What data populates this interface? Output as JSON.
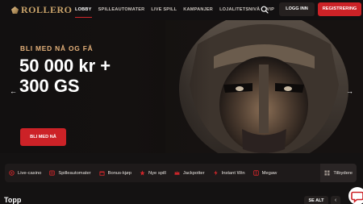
{
  "header": {
    "logo": "ROLLERO",
    "nav": [
      "LOBBY",
      "SPILLEAUTOMATER",
      "LIVE SPILL",
      "KAMPANJER",
      "LOJALITETSNIVÅ",
      "VIP"
    ],
    "login_label": "LOGG INN",
    "register_label": "REGISTRERING"
  },
  "hero": {
    "eyebrow": "BLI MED NÅ OG FÅ",
    "title_line1": "50 000 kr +",
    "title_line2": "300 GS",
    "cta": "BLI MED NÅ",
    "prev_arrow": "←",
    "next_arrow": "→",
    "slides_total": 5,
    "slide_active": 2
  },
  "categories": [
    {
      "label": "Live-casino",
      "icon": "live-casino-icon"
    },
    {
      "label": "Spilleautomater",
      "icon": "slot-machine-icon"
    },
    {
      "label": "Bonus-kjøp",
      "icon": "bonus-buy-icon"
    },
    {
      "label": "Nye spill",
      "icon": "new-games-icon"
    },
    {
      "label": "Jackpotter",
      "icon": "jackpot-icon"
    },
    {
      "label": "Instant Win",
      "icon": "instant-win-icon"
    },
    {
      "label": "Megaw",
      "icon": "megaways-icon"
    },
    {
      "label": "Tilbydere",
      "icon": "providers-icon"
    }
  ],
  "section": {
    "title": "Topp",
    "see_all": "SE ALT",
    "prev": "‹",
    "next": "›"
  },
  "colors": {
    "accent_red": "#cc2227",
    "gold": "#c9a36a",
    "eyebrow": "#e6b27b"
  }
}
